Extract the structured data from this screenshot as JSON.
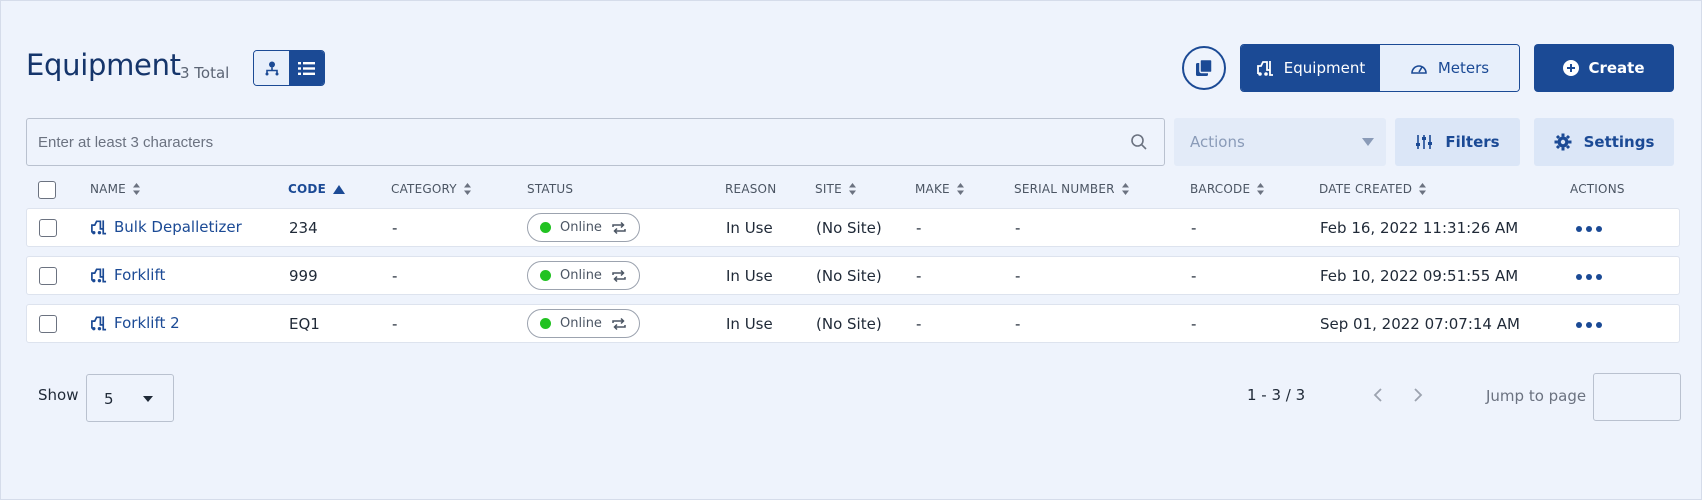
{
  "header": {
    "title": "Equipment",
    "total": "3 Total",
    "view_toggle": {
      "options": [
        "hierarchy-view",
        "list-view"
      ],
      "selected": "list-view"
    }
  },
  "top_actions": {
    "segments": [
      "Equipment",
      "Meters"
    ],
    "selected_segment": "Equipment",
    "create_label": "Create"
  },
  "toolbar": {
    "search_placeholder": "Enter at least 3 characters",
    "actions_label": "Actions",
    "filters_label": "Filters",
    "settings_label": "Settings"
  },
  "table": {
    "columns": [
      "NAME",
      "CODE",
      "CATEGORY",
      "STATUS",
      "REASON",
      "SITE",
      "MAKE",
      "SERIAL NUMBER",
      "BARCODE",
      "DATE CREATED",
      "ACTIONS"
    ],
    "sorted_column": "CODE",
    "sort_direction": "ascending",
    "rows": [
      {
        "name": "Bulk Depalletizer",
        "code": "234",
        "category": "-",
        "status": "Online",
        "reason": "In Use",
        "site": "(No Site)",
        "make": "-",
        "serial": "-",
        "barcode": "-",
        "date": "Feb 16, 2022 11:31:26 AM"
      },
      {
        "name": "Forklift",
        "code": "999",
        "category": "-",
        "status": "Online",
        "reason": "In Use",
        "site": "(No Site)",
        "make": "-",
        "serial": "-",
        "barcode": "-",
        "date": "Feb 10, 2022 09:51:55 AM"
      },
      {
        "name": "Forklift 2",
        "code": "EQ1",
        "category": "-",
        "status": "Online",
        "reason": "In Use",
        "site": "(No Site)",
        "make": "-",
        "serial": "-",
        "barcode": "-",
        "date": "Sep 01, 2022 07:07:14 AM"
      }
    ]
  },
  "footer": {
    "show_label": "Show",
    "page_size": "5",
    "range": "1 - 3 / 3",
    "jump_label": "Jump to page",
    "jump_value": ""
  },
  "colors": {
    "primary": "#1b4a95",
    "background": "#eef3fc",
    "status_online": "#22c222"
  }
}
